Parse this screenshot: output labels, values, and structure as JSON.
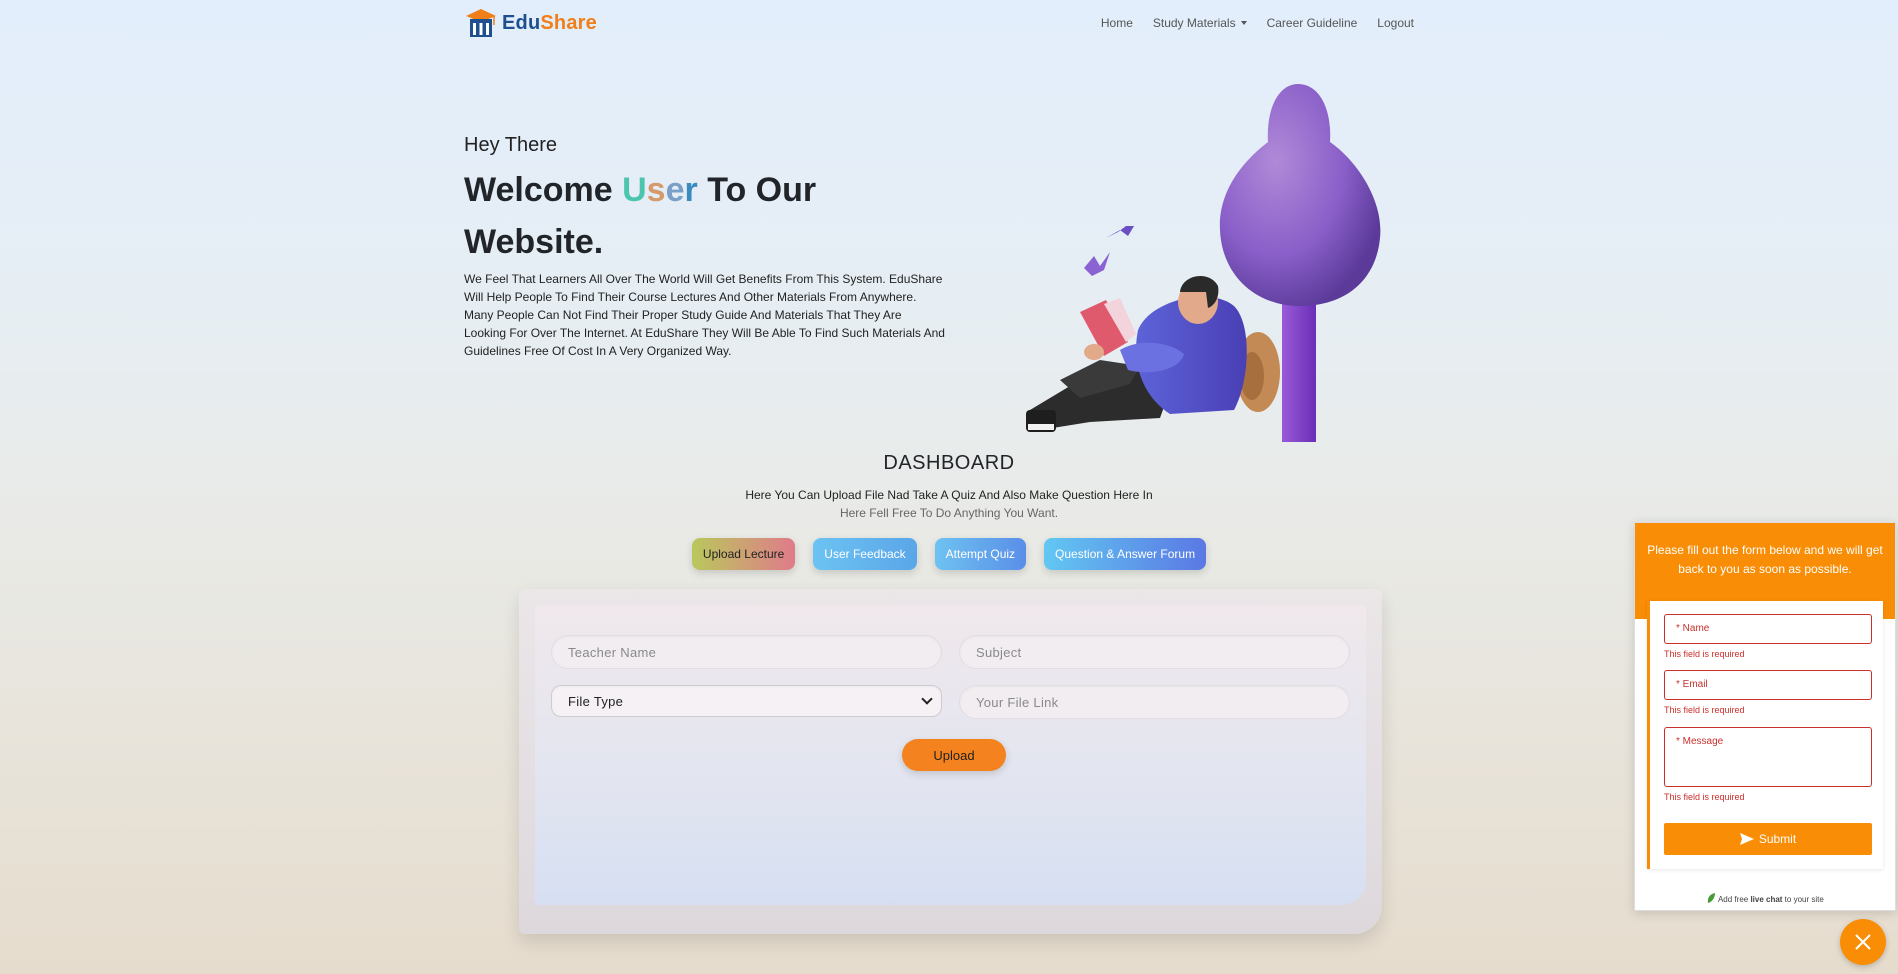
{
  "nav": {
    "brand_part1": "Edu",
    "brand_part2": "Share",
    "links": [
      "Home",
      "Study Materials",
      "Career Guideline",
      "Logout"
    ]
  },
  "hero": {
    "greeting": "Hey There",
    "title_before": "Welcome ",
    "title_user": [
      "U",
      "s",
      "e",
      "r"
    ],
    "title_after": " To Our Website.",
    "description": "We Feel That Learners All Over The World Will Get Benefits From This System. EduShare Will Help People To Find Their Course Lectures And Other Materials From Anywhere. Many People Can Not Find Their Proper Study Guide And Materials That They Are Looking For Over The Internet. At EduShare They Will Be Able To Find Such Materials And Guidelines Free Of Cost In A Very Organized Way."
  },
  "dashboard": {
    "title": "DASHBOARD",
    "subtitle1": "Here You Can Upload File Nad Take A Quiz And Also Make Question Here In",
    "subtitle2": "Here Fell Free To Do Anything You Want.",
    "tabs": [
      "Upload Lecture",
      "User Feedback",
      "Attempt Quiz",
      "Question & Answer Forum"
    ]
  },
  "upload_form": {
    "teacher_placeholder": "Teacher Name",
    "subject_placeholder": "Subject",
    "file_type_selected": "File Type",
    "link_placeholder": "Your File Link",
    "upload_label": "Upload"
  },
  "chat_widget": {
    "header_text": "Please fill out the form below and we will get back to you as soon as possible.",
    "name_label": "* Name",
    "email_label": "* Email",
    "message_label": "* Message",
    "error_text": "This field is required",
    "submit_label": "Submit",
    "footer_prefix": "Add free ",
    "footer_bold": "live chat",
    "footer_suffix": " to your site"
  },
  "colors": {
    "accent_orange": "#f98d06",
    "brand_blue": "#1e4f8f",
    "brand_orange": "#f07f1a"
  }
}
